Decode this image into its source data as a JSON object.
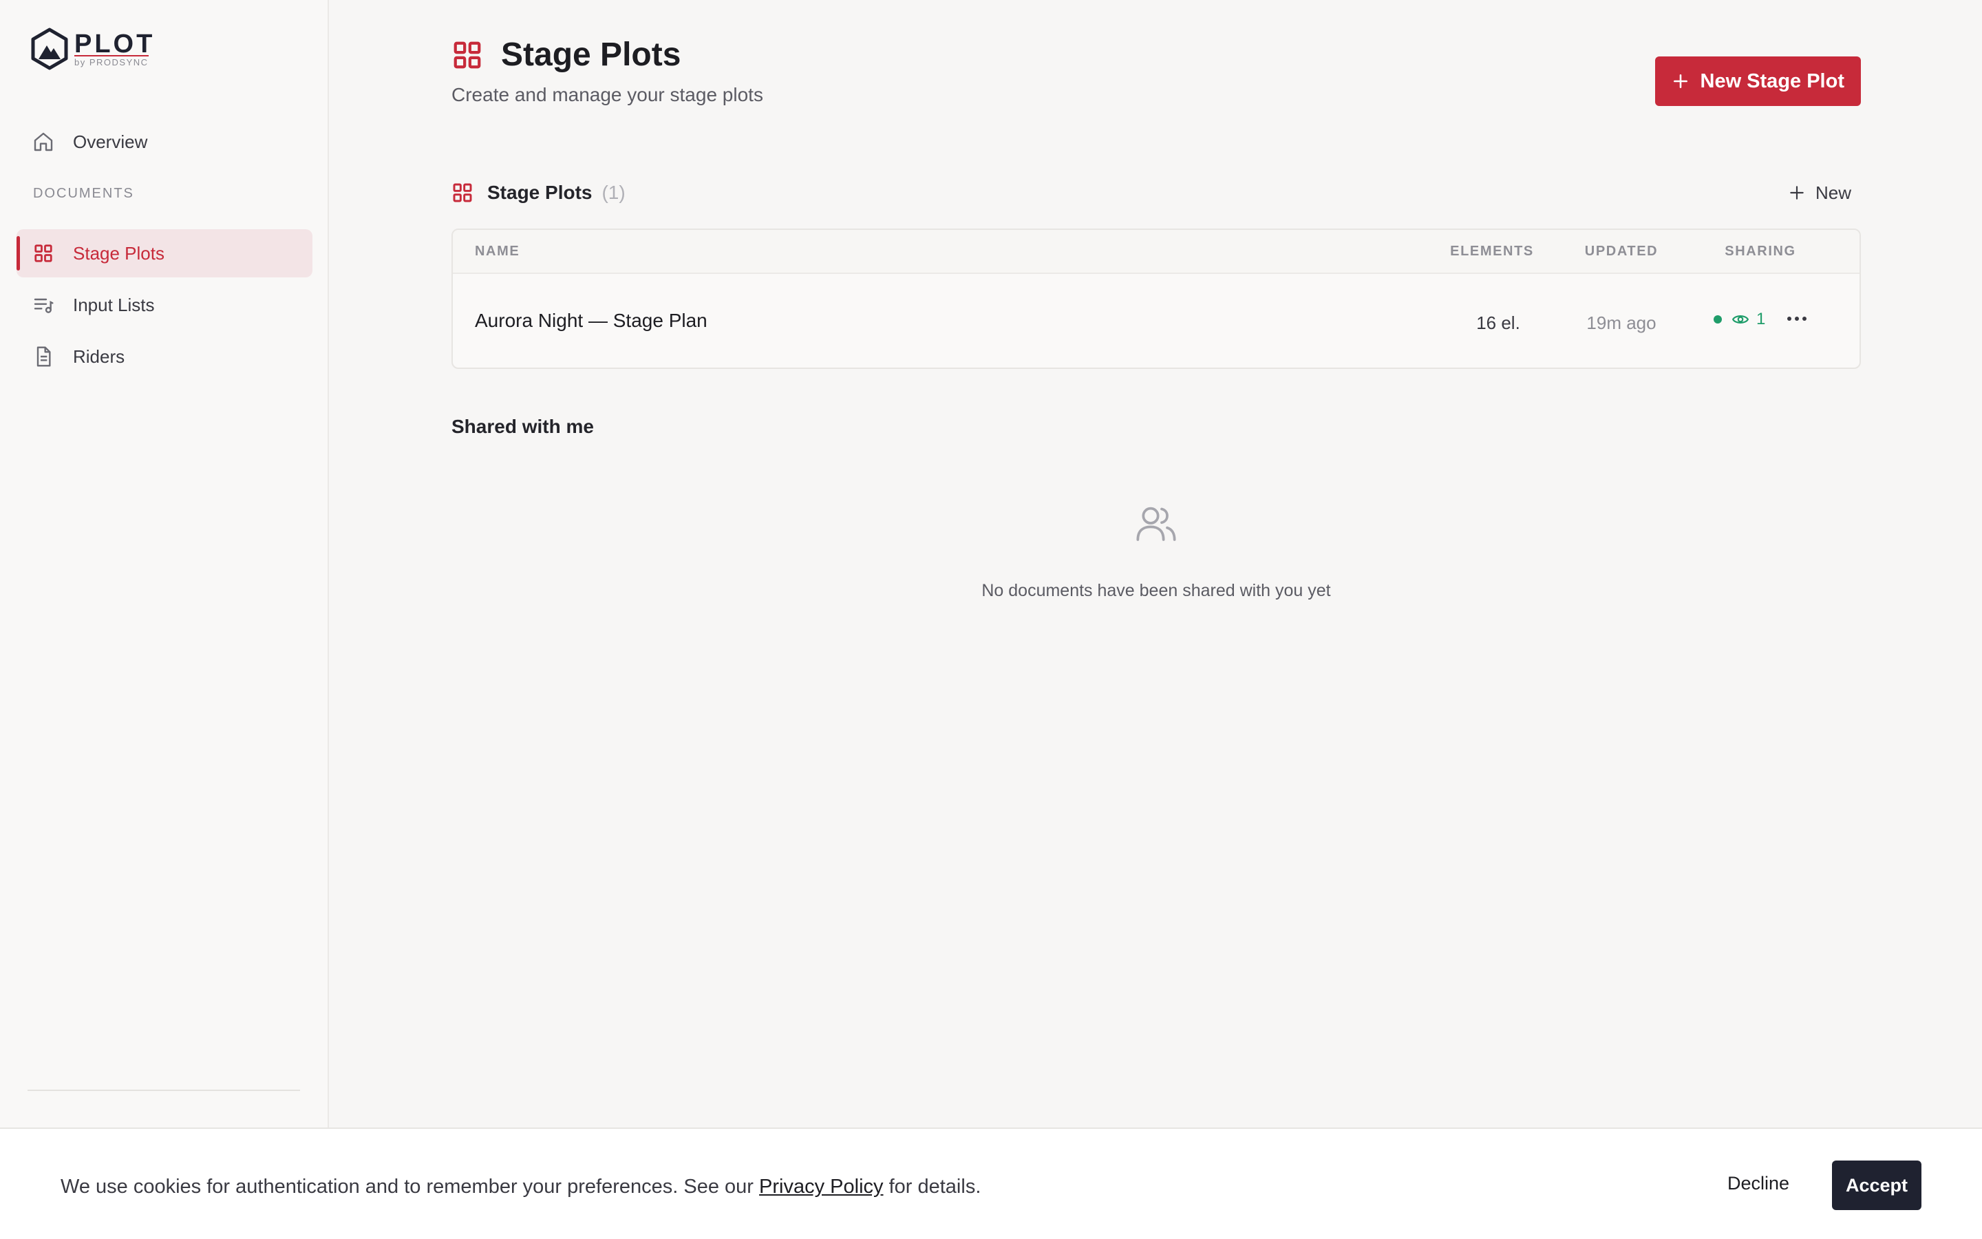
{
  "brand": {
    "name": "PLOT",
    "byline": "by PRODSYNC"
  },
  "sidebar": {
    "overview_label": "Overview",
    "section_label": "DOCUMENTS",
    "items": [
      {
        "label": "Stage Plots",
        "icon": "grid-icon",
        "active": true
      },
      {
        "label": "Input Lists",
        "icon": "list-music-icon",
        "active": false
      },
      {
        "label": "Riders",
        "icon": "document-icon",
        "active": false
      }
    ]
  },
  "header": {
    "title": "Stage Plots",
    "subtitle": "Create and manage your stage plots",
    "new_button_label": "New Stage Plot"
  },
  "list": {
    "title": "Stage Plots",
    "count": "(1)",
    "new_label": "New",
    "columns": [
      "NAME",
      "ELEMENTS",
      "UPDATED",
      "SHARING"
    ],
    "rows": [
      {
        "name": "Aurora Night — Stage Plan",
        "elements": "16 el.",
        "updated": "19m ago",
        "sharing_count": "1"
      }
    ]
  },
  "shared": {
    "title": "Shared with me",
    "empty_text": "No documents have been shared with you yet"
  },
  "cookie": {
    "text_before": "We use cookies for authentication and to remember your preferences. See our",
    "link_label": "Privacy Policy",
    "text_after": "for details.",
    "decline_label": "Decline",
    "accept_label": "Accept"
  },
  "colors": {
    "accent": "#c72a3a",
    "success": "#1f9d6a",
    "dark": "#1f2230"
  }
}
